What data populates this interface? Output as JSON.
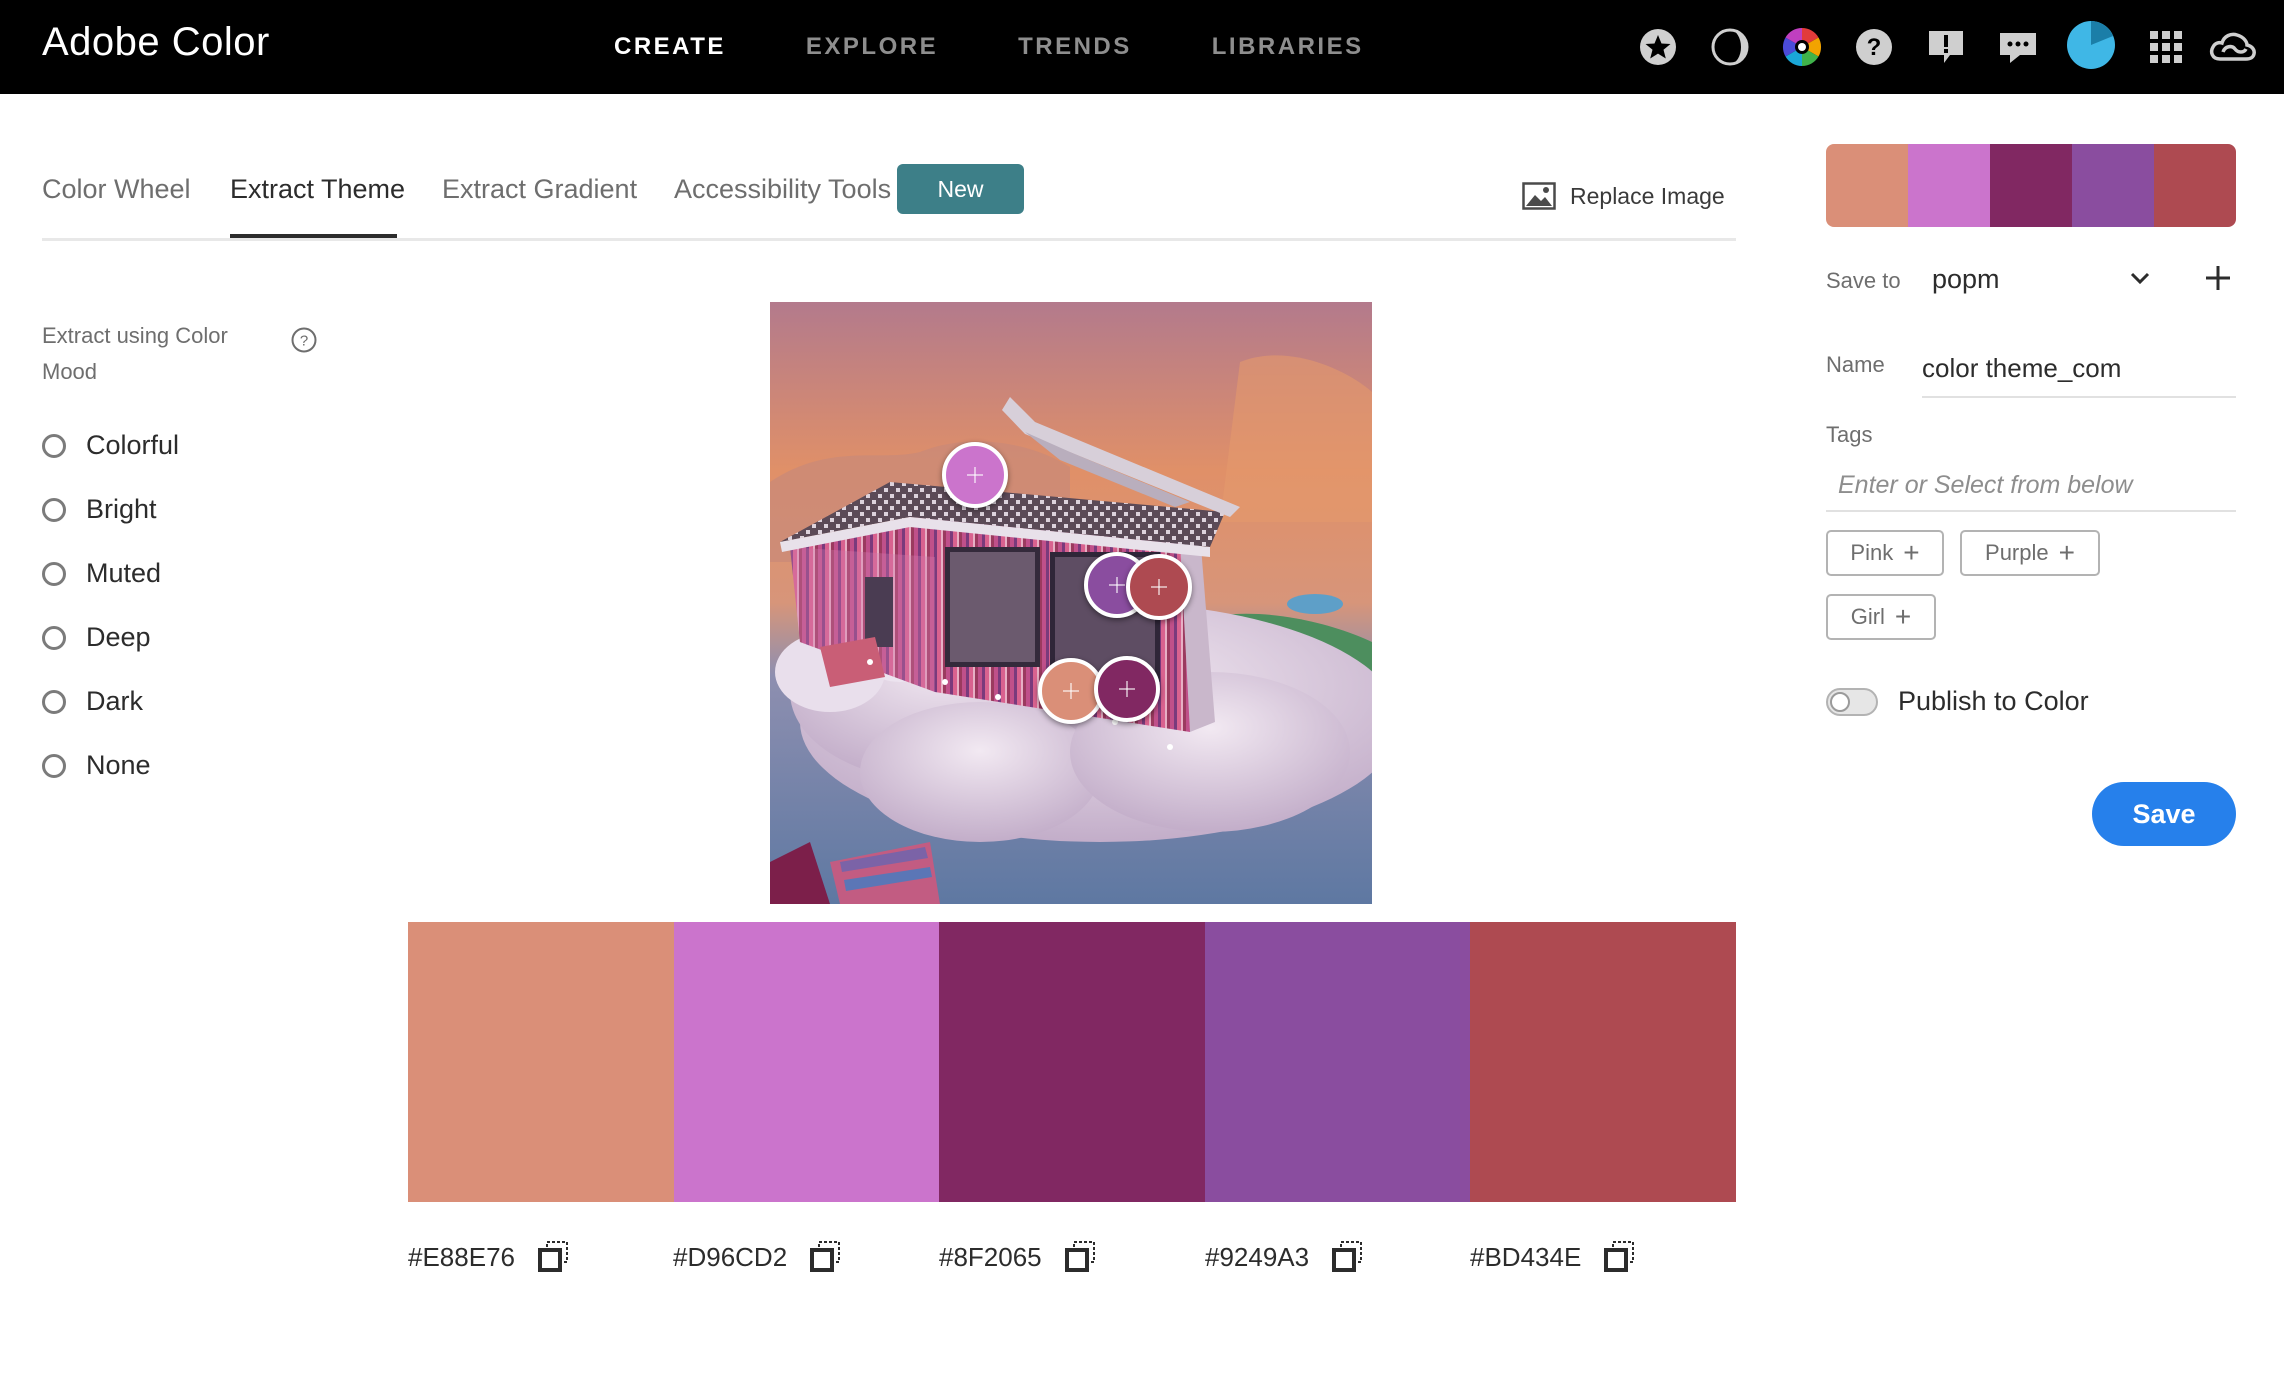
{
  "app": {
    "title": "Adobe Color"
  },
  "nav": {
    "links": [
      {
        "label": "CREATE",
        "active": true
      },
      {
        "label": "EXPLORE",
        "active": false
      },
      {
        "label": "TRENDS",
        "active": false
      },
      {
        "label": "LIBRARIES",
        "active": false
      }
    ],
    "icons": [
      "star-icon",
      "contrast-icon",
      "color-wheel-icon",
      "help-icon",
      "feedback-icon",
      "chat-icon",
      "avatar",
      "apps-grid-icon",
      "creative-cloud-icon"
    ]
  },
  "tabs": [
    {
      "label": "Color Wheel",
      "active": false
    },
    {
      "label": "Extract Theme",
      "active": true
    },
    {
      "label": "Extract Gradient",
      "active": false
    },
    {
      "label": "Accessibility Tools",
      "active": false
    }
  ],
  "badge_new": "New",
  "replace_image": "Replace Image",
  "mood": {
    "title": "Extract using Color Mood",
    "options": [
      "Colorful",
      "Bright",
      "Muted",
      "Deep",
      "Dark",
      "None"
    ],
    "selected": null
  },
  "theme": {
    "colors": [
      {
        "hex": "#E88E76",
        "display": "#DA8F78"
      },
      {
        "hex": "#D96CD2",
        "display": "#CB74CC"
      },
      {
        "hex": "#8F2065",
        "display": "#812862"
      },
      {
        "hex": "#9249A3",
        "display": "#8A4D9F"
      },
      {
        "hex": "#BD434E",
        "display": "#AE4A51"
      }
    ]
  },
  "save_panel": {
    "save_to_label": "Save to",
    "save_to_value": "popm",
    "name_label": "Name",
    "name_value": "color theme_com",
    "tags_label": "Tags",
    "tags_placeholder": "Enter or Select from below",
    "suggested_tags": [
      "Pink",
      "Purple",
      "Girl"
    ],
    "publish_label": "Publish to Color",
    "publish_enabled": false,
    "save_button": "Save"
  },
  "colors": {
    "accent": "#2680EB",
    "badge": "#3D7F88",
    "topbar": "#000000"
  }
}
